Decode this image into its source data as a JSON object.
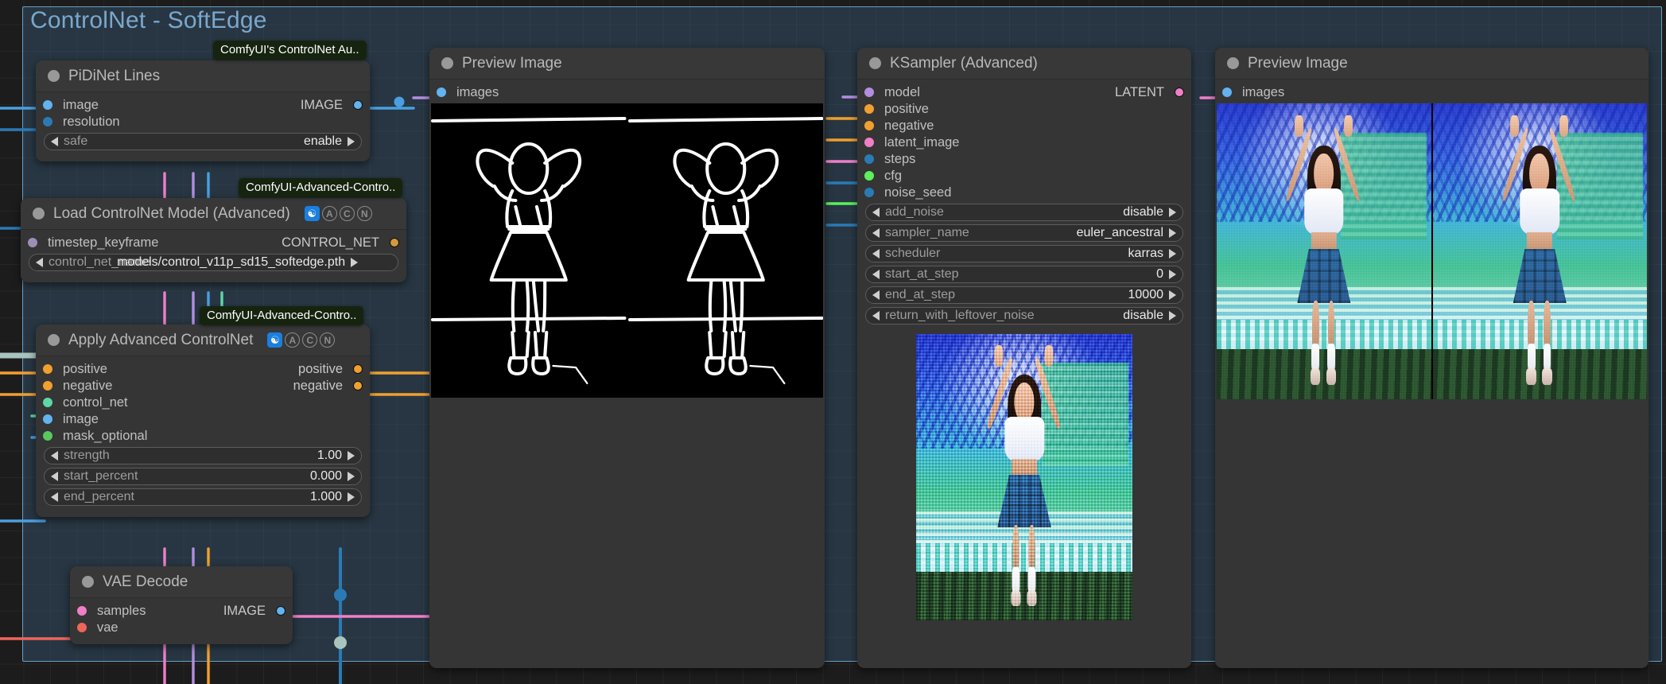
{
  "group": {
    "title": "ControlNet - SoftEdge"
  },
  "package_tags": {
    "pidinet": "ComfyUI's ControlNet Au..",
    "loader": "ComfyUI-Advanced-Contro..",
    "apply": "ComfyUI-Advanced-Contro.."
  },
  "nodes": {
    "pidinet": {
      "title": "PiDiNet Lines",
      "inputs": [
        {
          "name": "image",
          "color": "#62b3f0"
        },
        {
          "name": "resolution",
          "color": "#2a7ab5"
        }
      ],
      "outputs": [
        {
          "name": "IMAGE",
          "color": "#62b3f0"
        }
      ],
      "widgets": [
        {
          "name": "safe",
          "value": "enable"
        }
      ]
    },
    "loader": {
      "title": "Load ControlNet Model (Advanced)",
      "badges": [
        "♻",
        "A",
        "C",
        "N"
      ],
      "inputs": [
        {
          "name": "timestep_keyframe",
          "color": "#9b8fb5"
        }
      ],
      "outputs": [
        {
          "name": "CONTROL_NET",
          "color": "#d49a3a"
        }
      ],
      "widgets": [
        {
          "name": "control_net_name",
          "value": "models/control_v11p_sd15_softedge.pth"
        }
      ]
    },
    "apply": {
      "title": "Apply Advanced ControlNet",
      "badges": [
        "♻",
        "A",
        "C",
        "N"
      ],
      "inputs": [
        {
          "name": "positive",
          "color": "#f0a030"
        },
        {
          "name": "negative",
          "color": "#f0a030"
        },
        {
          "name": "control_net",
          "color": "#5fd6a8"
        },
        {
          "name": "image",
          "color": "#62b3f0"
        },
        {
          "name": "mask_optional",
          "color": "#59c95f"
        }
      ],
      "outputs": [
        {
          "name": "positive",
          "color": "#f0a030"
        },
        {
          "name": "negative",
          "color": "#f0a030"
        }
      ],
      "widgets": [
        {
          "name": "strength",
          "value": "1.00"
        },
        {
          "name": "start_percent",
          "value": "0.000"
        },
        {
          "name": "end_percent",
          "value": "1.000"
        }
      ]
    },
    "vae_decode": {
      "title": "VAE Decode",
      "inputs": [
        {
          "name": "samples",
          "color": "#ef7fc8"
        },
        {
          "name": "vae",
          "color": "#f0655a"
        }
      ],
      "outputs": [
        {
          "name": "IMAGE",
          "color": "#62b3f0"
        }
      ]
    },
    "preview_left": {
      "title": "Preview Image",
      "inputs": [
        {
          "name": "images",
          "color": "#62b3f0"
        }
      ]
    },
    "preview_right": {
      "title": "Preview Image",
      "inputs": [
        {
          "name": "images",
          "color": "#62b3f0"
        }
      ]
    },
    "ksampler": {
      "title": "KSampler (Advanced)",
      "inputs": [
        {
          "name": "model",
          "color": "#b38ee0"
        },
        {
          "name": "positive",
          "color": "#f0a030"
        },
        {
          "name": "negative",
          "color": "#f0a030"
        },
        {
          "name": "latent_image",
          "color": "#ef7fc8"
        },
        {
          "name": "steps",
          "color": "#2a7ab5"
        },
        {
          "name": "cfg",
          "color": "#5cf05c"
        },
        {
          "name": "noise_seed",
          "color": "#2a7ab5"
        }
      ],
      "outputs": [
        {
          "name": "LATENT",
          "color": "#ef7fc8"
        }
      ],
      "widgets": [
        {
          "name": "add_noise",
          "value": "disable"
        },
        {
          "name": "sampler_name",
          "value": "euler_ancestral"
        },
        {
          "name": "scheduler",
          "value": "karras"
        },
        {
          "name": "start_at_step",
          "value": "0"
        },
        {
          "name": "end_at_step",
          "value": "10000"
        },
        {
          "name": "return_with_leftover_noise",
          "value": "disable"
        }
      ]
    }
  },
  "colors": {
    "canvas_bg": "#1c1c1c",
    "node_bg": "#353535",
    "node_title_bg": "#383838",
    "group_bg": "#3a5f7d",
    "group_border": "#6a9ec4",
    "group_title_text": "#7ba7cc",
    "link_blue": "#4a9fe0",
    "link_orange": "#f0a030",
    "link_pink": "#ef7fc8",
    "link_purple": "#b38ee0",
    "link_green": "#5fd6a8",
    "link_teal": "#a8c4bc"
  }
}
